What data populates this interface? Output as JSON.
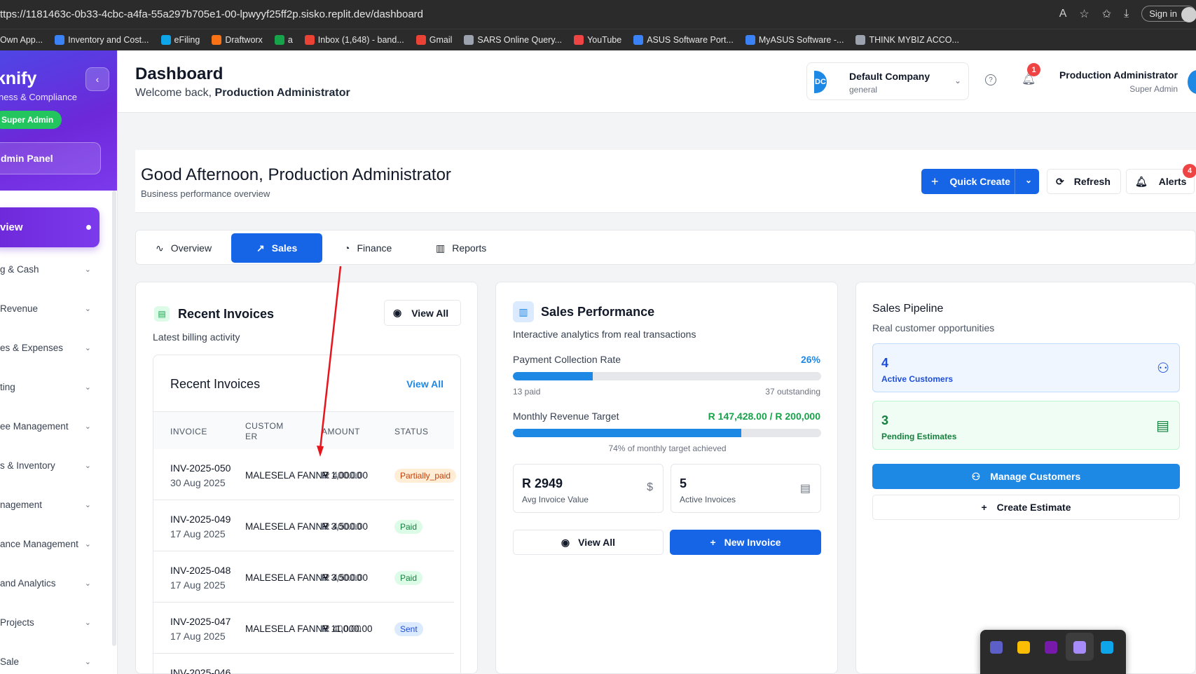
{
  "browser": {
    "url": "ttps://1181463c-0b33-4cbc-a4fa-55a297b705e1-00-lpwyyf25ff2p.sisko.replit.dev/dashboard",
    "signin": "Sign in",
    "bookmarks": [
      {
        "label": "Own App...",
        "color": "#2b2b2b"
      },
      {
        "label": "Inventory and Cost...",
        "color": "#3b82f6"
      },
      {
        "label": "eFiling",
        "color": "#0ea5e9"
      },
      {
        "label": "Draftworx",
        "color": "#f97316"
      },
      {
        "label": "a",
        "color": "#16a34a"
      },
      {
        "label": "Inbox (1,648) - band...",
        "color": "#ea4335"
      },
      {
        "label": "Gmail",
        "color": "#ea4335"
      },
      {
        "label": "SARS Online Query...",
        "color": "#9ca3af"
      },
      {
        "label": "YouTube",
        "color": "#ef4444"
      },
      {
        "label": "ASUS Software Port...",
        "color": "#3b82f6"
      },
      {
        "label": "MyASUS Software -...",
        "color": "#3b82f6"
      },
      {
        "label": "THINK MYBIZ ACCO...",
        "color": "#9ca3af"
      }
    ]
  },
  "sidebar": {
    "brand": "knify",
    "subtitle": "ness & Compliance",
    "badge": "Super Admin",
    "admin_panel": "dmin Panel",
    "active": "view",
    "items": [
      {
        "label": "g & Cash"
      },
      {
        "label": "Revenue"
      },
      {
        "label": "es & Expenses"
      },
      {
        "label": "ting"
      },
      {
        "label": "ee Management"
      },
      {
        "label": "s & Inventory"
      },
      {
        "label": "nagement"
      },
      {
        "label": "ance Management"
      },
      {
        "label": " and Analytics"
      },
      {
        "label": "Projects"
      },
      {
        "label": " Sale"
      }
    ]
  },
  "header": {
    "title": "Dashboard",
    "welcome_prefix": "Welcome back,",
    "welcome_name": "Production Administrator",
    "company_name": "Default Company",
    "company_sub": "general",
    "company_logo": "DC",
    "notifications": "1",
    "user_name": "Production Administrator",
    "user_role": "Super Admin"
  },
  "greeting": {
    "title": "Good Afternoon, Production Administrator",
    "subtitle": "Business performance overview",
    "quick_create": "Quick Create",
    "refresh": "Refresh",
    "alerts": "Alerts",
    "alerts_count": "4"
  },
  "tabs": [
    {
      "label": "Overview"
    },
    {
      "label": "Sales"
    },
    {
      "label": "Finance"
    },
    {
      "label": "Reports"
    }
  ],
  "invoices": {
    "title": "Recent Invoices",
    "subtitle": "Latest billing activity",
    "view_all": "View All",
    "inner_title": "Recent Invoices",
    "inner_view_all": "View All",
    "columns": [
      "INVOICE",
      "CUSTOM ER",
      "AMOUNT",
      "STATUS"
    ],
    "rows": [
      {
        "invoice": "INV-2025-050",
        "date": "30 Aug 2025",
        "customer": "MALESELA FANNY",
        "amount": "R 1,000.00",
        "amount_overlap": "R 400.00",
        "status": "Partially_paid",
        "kind": "partial"
      },
      {
        "invoice": "INV-2025-049",
        "date": "17 Aug 2025",
        "customer": "MALESELA FANNY",
        "amount": "R 3,500.00",
        "amount_overlap": "R 400.00",
        "status": "Paid",
        "kind": "paid"
      },
      {
        "invoice": "INV-2025-048",
        "date": "17 Aug 2025",
        "customer": "MALESELA FANNY",
        "amount": "R 3,500.00",
        "amount_overlap": "R 400.00",
        "status": "Paid",
        "kind": "paid"
      },
      {
        "invoice": "INV-2025-047",
        "date": "17 Aug 2025",
        "customer": "MALESELA FANNY",
        "amount": "R 11,000.00",
        "amount_overlap": "R 400.00",
        "status": "Sent",
        "kind": "sent"
      },
      {
        "invoice": "INV-2025-046",
        "date": "",
        "customer": "",
        "amount": "",
        "amount_overlap": "",
        "status": "",
        "kind": "partial"
      }
    ]
  },
  "sales": {
    "title": "Sales Performance",
    "subtitle": "Interactive analytics from real transactions",
    "collection_label": "Payment Collection Rate",
    "collection_value": "26%",
    "collection_fraction": 0.26,
    "paid_text": "13 paid",
    "outstanding_text": "37 outstanding",
    "target_label": "Monthly Revenue Target",
    "target_value": "R 147,428.00 / R 200,000",
    "target_fraction": 0.74,
    "target_caption": "74% of monthly target achieved",
    "avg_value": "R 2949",
    "avg_label": "Avg Invoice Value",
    "active_value": "5",
    "active_label": "Active Invoices",
    "view_all": "View All",
    "new_invoice": "New Invoice"
  },
  "pipeline": {
    "title": "Sales Pipeline",
    "subtitle": "Real customer opportunities",
    "active_customers": "4",
    "active_customers_label": "Active Customers",
    "pending_estimates": "3",
    "pending_estimates_label": "Pending Estimates",
    "manage_customers": "Manage Customers",
    "create_estimate": "Create Estimate"
  }
}
